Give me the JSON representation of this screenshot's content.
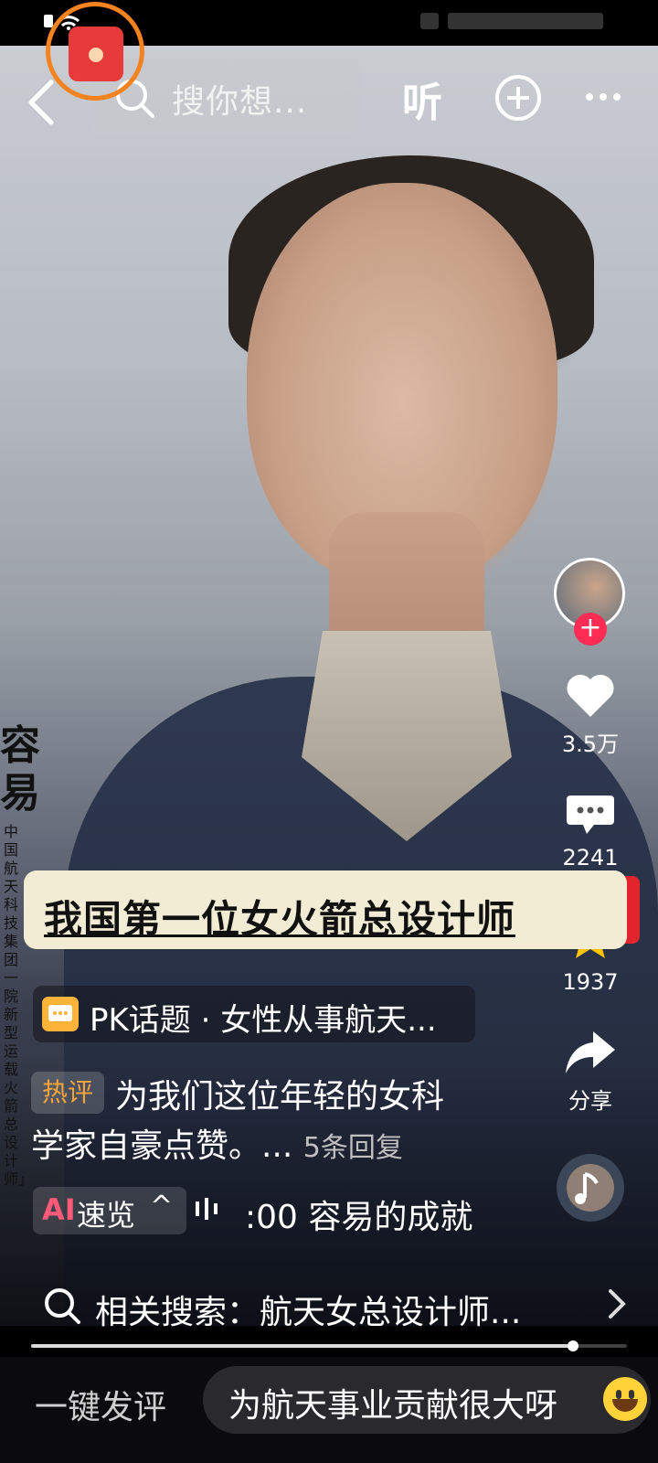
{
  "search": {
    "placeholder": "搜你想..."
  },
  "topbar": {
    "listen_label": "听"
  },
  "side_caption": {
    "big_chars": "容\n易",
    "vertical_text": "中国航天科技集团一院新型运载火箭总设计师」"
  },
  "video": {
    "title_banner": "我国第一位女火箭总设计师"
  },
  "rail": {
    "likes": "3.5万",
    "comments": "2241",
    "favorites": "1937",
    "share_label": "分享"
  },
  "pk_topic": {
    "text": "PK话题 · 女性从事航天..."
  },
  "hot_comment": {
    "badge": "热评",
    "line1": "为我们这位年轻的女科",
    "line2": "学家自豪点赞。...",
    "replies": "5条回复"
  },
  "ai": {
    "tag": "AI",
    "label": "速览",
    "caret": "^",
    "summary": ":00 容易的成就"
  },
  "related": {
    "label": "相关搜索：航天女总设计师..."
  },
  "progress": {
    "fraction": 0.91
  },
  "bottom": {
    "quick_comment": "一键发评",
    "suggestion": "为航天事业贡献很大呀"
  },
  "colors": {
    "like_red": "#fe2c55",
    "favorite_gold": "#ffc400",
    "hot_orange": "#f7a53a",
    "banner_cream": "#f3ecd5",
    "ai_pink": "#ff5a78"
  }
}
